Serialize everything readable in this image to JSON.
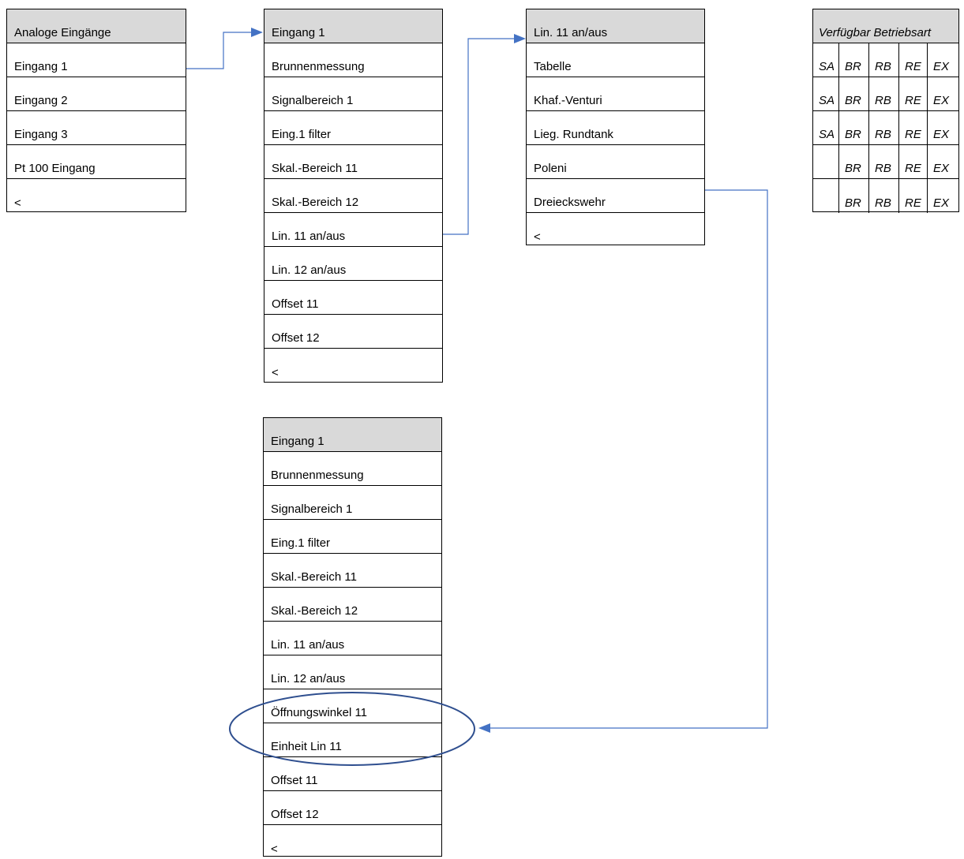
{
  "menu_analog": {
    "items": [
      "Analoge Eingänge",
      "Eingang 1",
      "Eingang 2",
      "Eingang 3",
      "Pt 100 Eingang",
      "<"
    ]
  },
  "menu_input1": {
    "items": [
      "Eingang 1",
      "Brunnenmessung",
      "Signalbereich 1",
      "Eing.1 filter",
      "Skal.-Bereich 11",
      "Skal.-Bereich 12",
      "Lin. 11 an/aus",
      "Lin. 12 an/aus",
      "Offset 11",
      "Offset 12",
      "<"
    ]
  },
  "menu_lin11": {
    "items": [
      "Lin. 11 an/aus",
      "Tabelle",
      "Khaf.-Venturi",
      "Lieg. Rundtank",
      "Poleni",
      "Dreieckswehr",
      "<"
    ]
  },
  "menu_input1_extended": {
    "items": [
      "Eingang 1",
      "Brunnenmessung",
      "Signalbereich 1",
      "Eing.1 filter",
      "Skal.-Bereich 11",
      "Skal.-Bereich 12",
      "Lin. 11 an/aus",
      "Lin. 12 an/aus",
      "Öffnungswinkel 11",
      "Einheit Lin 11",
      "Offset 11",
      "Offset 12",
      "<"
    ]
  },
  "modes_table": {
    "title": "Verfügbar Betriebsart",
    "rows": [
      [
        "SA",
        "BR",
        "RB",
        "RE",
        "EX"
      ],
      [
        "SA",
        "BR",
        "RB",
        "RE",
        "EX"
      ],
      [
        "SA",
        "BR",
        "RB",
        "RE",
        "EX"
      ],
      [
        "",
        "BR",
        "RB",
        "RE",
        "EX"
      ],
      [
        "",
        "BR",
        "RB",
        "RE",
        "EX"
      ]
    ]
  },
  "colors": {
    "connector": "#4472c4",
    "highlight_ellipse": "#2f4f8f",
    "header_fill": "#d9d9d9"
  }
}
